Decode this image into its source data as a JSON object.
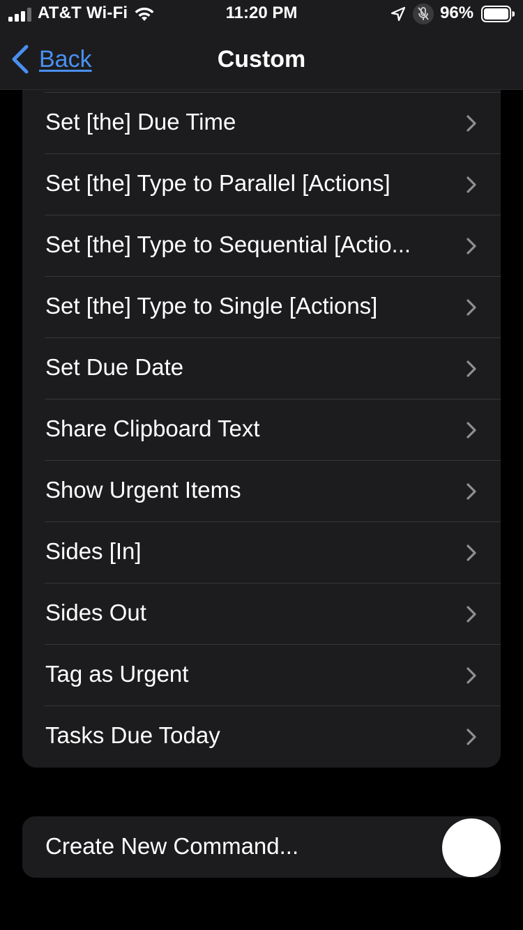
{
  "status_bar": {
    "carrier": "AT&T Wi-Fi",
    "time": "11:20 PM",
    "battery_percent": "96%",
    "icons": [
      "signal-bars-icon",
      "wifi-icon",
      "location-arrow-icon",
      "mute-mic-icon",
      "battery-icon"
    ]
  },
  "nav": {
    "back_label": "Back",
    "title": "Custom"
  },
  "list": {
    "items": [
      {
        "label": "Set [the] Due Time"
      },
      {
        "label": "Set [the] Type to Parallel [Actions]"
      },
      {
        "label": "Set [the] Type to Sequential [Actio..."
      },
      {
        "label": "Set [the] Type to Single [Actions]"
      },
      {
        "label": "Set Due Date"
      },
      {
        "label": "Share Clipboard Text"
      },
      {
        "label": "Show Urgent Items"
      },
      {
        "label": "Sides [In]"
      },
      {
        "label": "Sides Out"
      },
      {
        "label": "Tag as Urgent"
      },
      {
        "label": "Tasks Due Today"
      }
    ]
  },
  "create": {
    "label": "Create New Command..."
  },
  "colors": {
    "background": "#000000",
    "group_background": "#1c1c1e",
    "accent": "#4a90f0",
    "chevron": "#8e8e93",
    "divider": "#38383a"
  }
}
